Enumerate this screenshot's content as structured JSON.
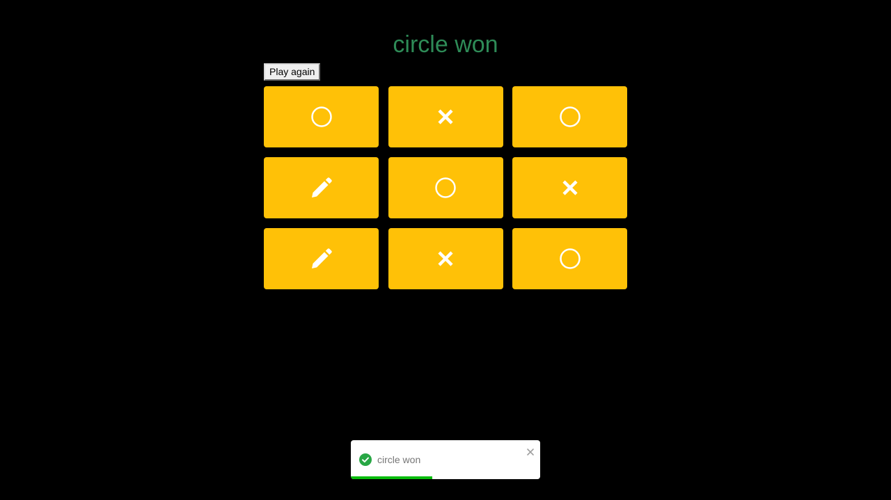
{
  "status": {
    "title": "circle won"
  },
  "controls": {
    "play_again_label": "Play again"
  },
  "board": {
    "cells": [
      "circle",
      "cross",
      "circle",
      "pencil",
      "circle",
      "cross",
      "pencil",
      "cross",
      "circle"
    ]
  },
  "toast": {
    "message": "circle won",
    "icon": "check-circle-icon",
    "close_icon": "close-icon",
    "progress_fraction": 0.43
  },
  "colors": {
    "background": "#000000",
    "title": "#2e8b57",
    "cell": "#ffc107",
    "mark": "#ffffff",
    "toast_success": "#28a745",
    "toast_progress": "#07bc0c"
  }
}
